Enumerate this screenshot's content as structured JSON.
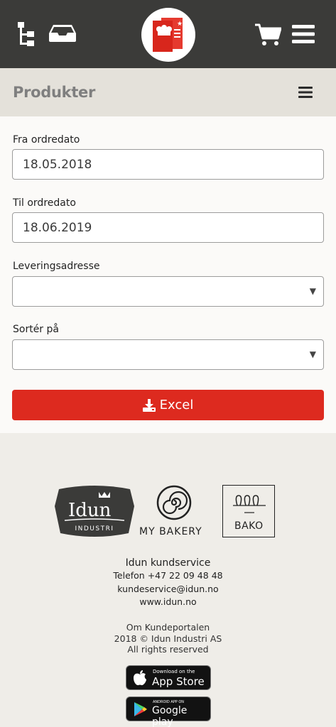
{
  "header": {
    "icons": [
      "hierarchy-icon",
      "inbox-icon",
      "cart-icon",
      "menu-icon"
    ],
    "logo": "idun-kundeportal-logo"
  },
  "page": {
    "title": "Produkter"
  },
  "form": {
    "from_label": "Fra ordredato",
    "from_value": "18.05.2018",
    "to_label": "Til ordredato",
    "to_value": "18.06.2019",
    "address_label": "Leveringsadresse",
    "address_value": "",
    "sort_label": "Sortér på",
    "sort_value": "",
    "excel_label": "Excel"
  },
  "footer": {
    "brands": {
      "idun": "Idun",
      "idun_sub": "INDUSTRI",
      "mybakery": "MY BAKERY",
      "bako": "BAKO"
    },
    "service_title": "Idun kundservice",
    "phone": "Telefon +47 22 09 48 48",
    "email": "kundeservice@idun.no",
    "website": "www.idun.no",
    "about": "Om Kundeportalen",
    "copyright": "2018 © Idun Industri AS",
    "rights": "All rights reserved",
    "appstore_small": "Download on the",
    "appstore_big": "App Store",
    "googleplay_small": "ANDROID APP ON",
    "googleplay_big": "Google play"
  },
  "colors": {
    "header_bg": "#3b3b39",
    "accent_red": "#dd2a1f",
    "subheader_bg": "#e4e1da",
    "footer_bg": "#efede8"
  }
}
